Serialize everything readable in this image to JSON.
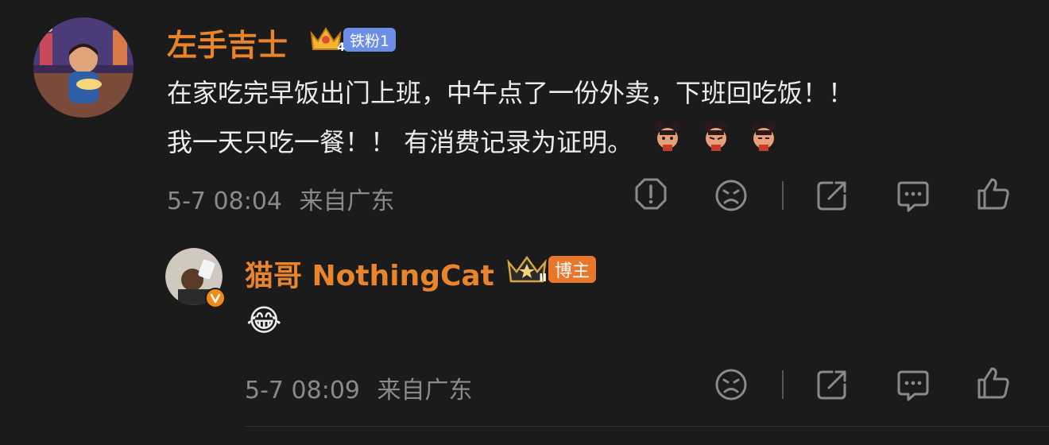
{
  "comments": [
    {
      "username": "左手吉士",
      "badge": {
        "level": "4",
        "label": "铁粉1",
        "color": "#6b8ee6"
      },
      "line1": "在家吃完早饭出门上班，中午点了一份外卖，下班回吃饭！！",
      "line2": "我一天只吃一餐！！ 有消费记录为证明。",
      "time": "5-7 08:04",
      "location": "来自广东",
      "actions": [
        "report-icon",
        "dislike-icon",
        "share-icon",
        "comment-icon",
        "like-icon"
      ]
    },
    {
      "username": "猫哥 NothingCat",
      "badge": {
        "level": "II",
        "label": "博主",
        "color": "#e8762c"
      },
      "text": "😂",
      "time": "5-7 08:09",
      "location": "来自广东",
      "actions": [
        "dislike-icon",
        "share-icon",
        "comment-icon",
        "like-icon"
      ]
    }
  ],
  "colors": {
    "background": "#1b1b1b",
    "username": "#e8842c",
    "meta": "#8a8a8a",
    "text": "#ececec"
  }
}
